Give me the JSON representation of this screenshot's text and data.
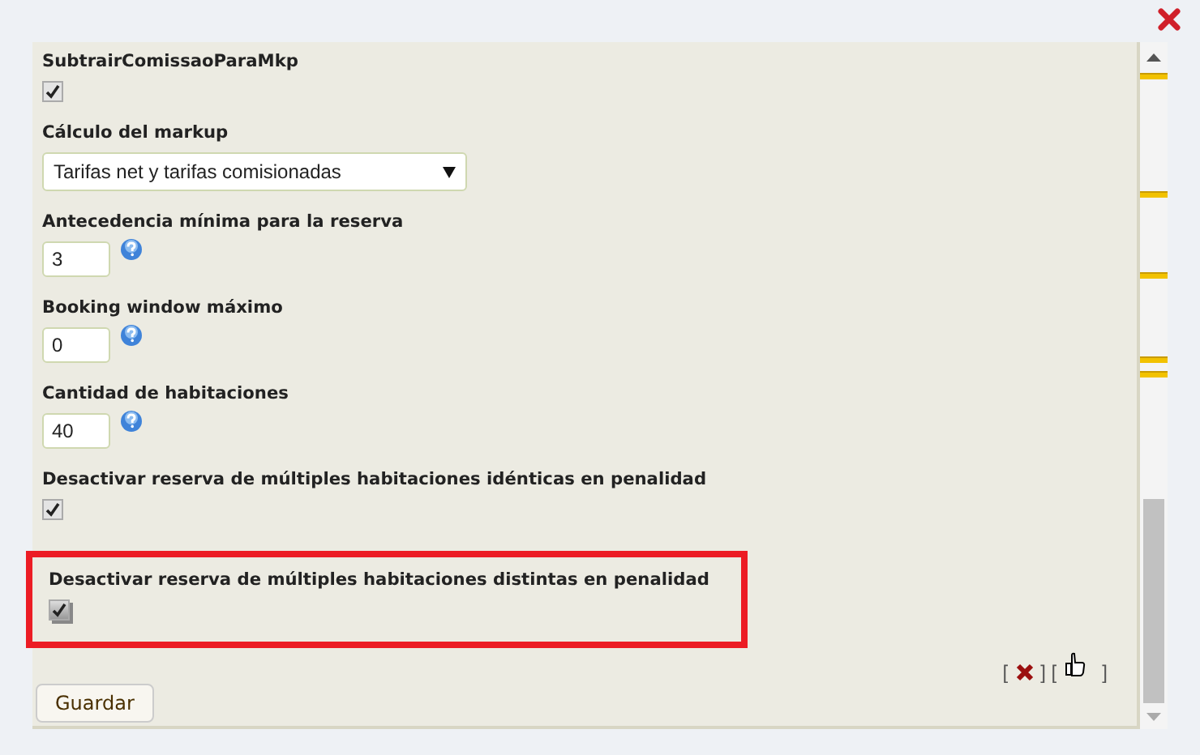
{
  "fields": [
    {
      "kind": "checkbox",
      "label": "SubtrairComissaoParaMkp",
      "checked": true,
      "highlighted": false
    },
    {
      "kind": "select",
      "label": "Cálculo del markup",
      "value": "Tarifas net y tarifas comisionadas",
      "highlighted": false
    },
    {
      "kind": "number",
      "label": "Antecedencia mínima para la reserva",
      "value": "3",
      "highlighted": false
    },
    {
      "kind": "number",
      "label": "Booking window máximo",
      "value": "0",
      "highlighted": false
    },
    {
      "kind": "number",
      "label": "Cantidad de habitaciones",
      "value": "40",
      "highlighted": false
    },
    {
      "kind": "checkbox",
      "label": "Desactivar reserva de múltiples habitaciones idénticas en penalidad",
      "checked": true,
      "highlighted": false
    },
    {
      "kind": "checkbox",
      "label": "Desactivar reserva de múltiples habitaciones distintas en penalidad",
      "checked": true,
      "highlighted": true
    }
  ],
  "actions": {
    "open_bracket": "[",
    "middle_brackets": "] [",
    "close_bracket": "]"
  },
  "save_button": "Guardar"
}
